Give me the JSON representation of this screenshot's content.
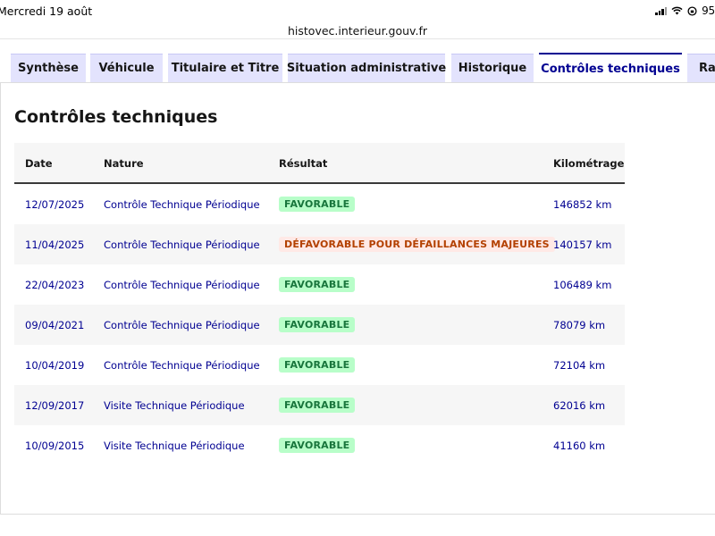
{
  "status_bar": {
    "date": "Mercredi 19 août",
    "battery": "95"
  },
  "browser": {
    "url": "histovec.interieur.gouv.fr"
  },
  "tabs": [
    {
      "label": "Synthèse"
    },
    {
      "label": "Véhicule"
    },
    {
      "label": "Titulaire et Titre"
    },
    {
      "label": "Situation administrative"
    },
    {
      "label": "Historique"
    },
    {
      "label": "Contrôles techniques"
    },
    {
      "label": "Rap"
    }
  ],
  "active_tab": "Contrôles techniques",
  "section": {
    "title": "Contrôles techniques"
  },
  "table": {
    "headers": {
      "date": "Date",
      "nature": "Nature",
      "result": "Résultat",
      "mileage": "Kilométrage"
    },
    "rows": [
      {
        "date": "12/07/2025",
        "nature": "Contrôle Technique Périodique",
        "result": "FAVORABLE",
        "mileage": "146852 km",
        "status": "ok"
      },
      {
        "date": "11/04/2025",
        "nature": "Contrôle Technique Périodique",
        "result": "DÉFAVORABLE POUR DÉFAILLANCES MAJEURES",
        "mileage": "140157 km",
        "status": "ko"
      },
      {
        "date": "22/04/2023",
        "nature": "Contrôle Technique Périodique",
        "result": "FAVORABLE",
        "mileage": "106489 km",
        "status": "ok"
      },
      {
        "date": "09/04/2021",
        "nature": "Contrôle Technique Périodique",
        "result": "FAVORABLE",
        "mileage": "78079 km",
        "status": "ok"
      },
      {
        "date": "10/04/2019",
        "nature": "Contrôle Technique Périodique",
        "result": "FAVORABLE",
        "mileage": "72104 km",
        "status": "ok"
      },
      {
        "date": "12/09/2017",
        "nature": "Visite Technique Périodique",
        "result": "FAVORABLE",
        "mileage": "62016 km",
        "status": "ok"
      },
      {
        "date": "10/09/2015",
        "nature": "Visite Technique Périodique",
        "result": "FAVORABLE",
        "mileage": "41160 km",
        "status": "ok"
      }
    ]
  },
  "colors": {
    "accent": "#000091",
    "tab_bg": "#e3e3fd",
    "favorable_bg": "#b8fec9",
    "favorable_text": "#18753c",
    "defavorable_bg": "#ffe9e6",
    "defavorable_text": "#b34000"
  },
  "icons": [
    "signal-icon",
    "wifi-icon",
    "rotation-lock-icon"
  ]
}
